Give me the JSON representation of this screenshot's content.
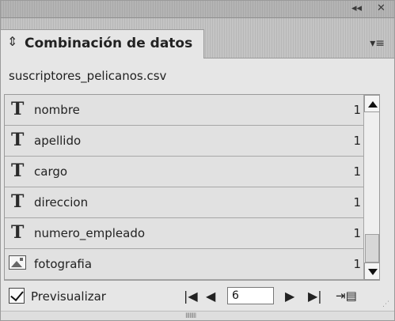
{
  "titlebar": {
    "collapse_icon": "double-left-arrow-icon",
    "close_icon": "close-icon"
  },
  "tab": {
    "title": "Combinación de datos",
    "updown_icon": "updown-arrows-icon",
    "menu_icon": "panel-menu-icon"
  },
  "source_file": "suscriptores_pelicanos.csv",
  "fields": [
    {
      "type": "text",
      "name": "nombre",
      "count": "1"
    },
    {
      "type": "text",
      "name": "apellido",
      "count": "1"
    },
    {
      "type": "text",
      "name": "cargo",
      "count": "1"
    },
    {
      "type": "text",
      "name": "direccion",
      "count": "1"
    },
    {
      "type": "text",
      "name": "numero_empleado",
      "count": "1"
    },
    {
      "type": "image",
      "name": "fotografia",
      "count": "1"
    }
  ],
  "text_field_glyph": "T",
  "footer": {
    "preview_label": "Previsualizar",
    "preview_checked": true,
    "record_value": "6"
  },
  "glyphs": {
    "collapse": "◂◂",
    "close": "✕",
    "updown": "⇕",
    "menu": "▾≡",
    "first": "|◀",
    "prev": "◀",
    "next": "▶",
    "last": "▶|",
    "create": "⇥▤",
    "handle": "IIIIIIII"
  }
}
